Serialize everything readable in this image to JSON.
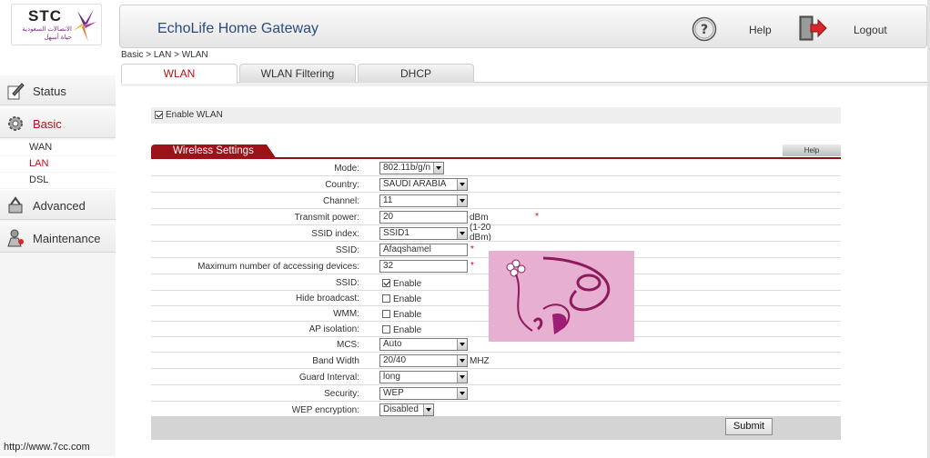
{
  "header": {
    "logo_text": "STC",
    "logo_arabic": "الاتصالات السعودية",
    "logo_arabic_sub": "حياة أسهل",
    "app_title": "EchoLife Home Gateway",
    "help_label": "Help",
    "logout_label": "Logout"
  },
  "sidebar": {
    "items": [
      {
        "label": "Status",
        "icon": "status-icon"
      },
      {
        "label": "Basic",
        "icon": "basic-gear-icon",
        "active": true
      },
      {
        "label": "Advanced",
        "icon": "advanced-icon"
      },
      {
        "label": "Maintenance",
        "icon": "maintenance-icon"
      }
    ],
    "subitems": [
      {
        "label": "WAN"
      },
      {
        "label": "LAN",
        "active": true
      },
      {
        "label": "DSL"
      }
    ]
  },
  "breadcrumb": "Basic > LAN > WLAN",
  "tabs": [
    {
      "label": "WLAN",
      "active": true
    },
    {
      "label": "WLAN Filtering"
    },
    {
      "label": "DHCP"
    }
  ],
  "enable_wlan": {
    "label": "Enable WLAN",
    "checked": true
  },
  "section": {
    "title": "Wireless Settings",
    "help_label": "Help"
  },
  "fields": {
    "mode": {
      "label": "Mode:",
      "value": "802.11b/g/n"
    },
    "country": {
      "label": "Country:",
      "value": "SAUDI ARABIA"
    },
    "channel": {
      "label": "Channel:",
      "value": "11"
    },
    "transmit_power": {
      "label": "Transmit power:",
      "value": "20",
      "unit": "dBm (1-20 dBm)",
      "required": "*"
    },
    "ssid_index": {
      "label": "SSID index:",
      "value": "SSID1"
    },
    "ssid": {
      "label": "SSID:",
      "value": "Afaqshamel",
      "required": "*"
    },
    "max_devices": {
      "label": "Maximum number of accessing devices:",
      "value": "32",
      "required": "*"
    },
    "ssid_enable": {
      "label": "SSID:",
      "check_label": "Enable",
      "checked": true
    },
    "hide_broadcast": {
      "label": "Hide broadcast:",
      "check_label": "Enable",
      "checked": false
    },
    "wmm": {
      "label": "WMM:",
      "check_label": "Enable",
      "checked": false
    },
    "ap_isolation": {
      "label": "AP isolation:",
      "check_label": "Enable",
      "checked": false
    },
    "mcs": {
      "label": "MCS:",
      "value": "Auto"
    },
    "band_width": {
      "label": "Band Width",
      "value": "20/40",
      "unit": "MHZ"
    },
    "guard_interval": {
      "label": "Guard Interval:",
      "value": "long"
    },
    "security": {
      "label": "Security:",
      "value": "WEP"
    },
    "wep_encryption": {
      "label": "WEP encryption:",
      "value": "Disabled"
    }
  },
  "submit_label": "Submit",
  "watermark": "http://www.7cc.com",
  "colors": {
    "accent": "#9d1218",
    "title": "#2a4c80",
    "overlay_bg": "#e5a9cc"
  }
}
